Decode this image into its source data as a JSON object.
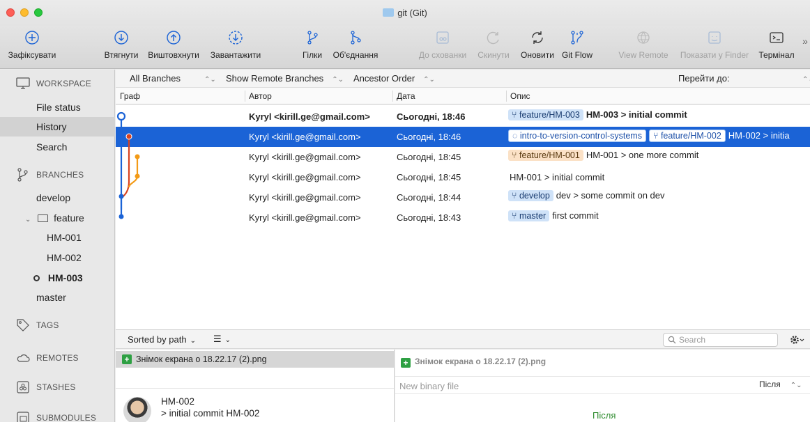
{
  "window": {
    "title": "git (Git)"
  },
  "toolbar": {
    "commit": "Зафіксувати",
    "pull": "Втягнути",
    "push": "Виштовхнути",
    "fetch": "Завантажити",
    "branch": "Гілки",
    "merge": "Об'єднання",
    "stash": "До схованки",
    "discard": "Скинути",
    "refresh": "Оновити",
    "gitflow": "Git Flow",
    "view_remote": "View Remote",
    "show_finder": "Показати у Finder",
    "terminal": "Термінал",
    "more": "»"
  },
  "sidebar": {
    "workspace": "WORKSPACE",
    "file_status": "File status",
    "history": "History",
    "search": "Search",
    "branches": "BRANCHES",
    "develop": "develop",
    "feature": "feature",
    "hm001": "HM-001",
    "hm002": "HM-002",
    "hm003": "HM-003",
    "master": "master",
    "tags": "TAGS",
    "remotes": "REMOTES",
    "stashes": "STASHES",
    "submodules": "SUBMODULES"
  },
  "filters": {
    "branches": "All Branches",
    "remote": "Show Remote Branches",
    "order": "Ancestor Order",
    "goto": "Перейти до:"
  },
  "columns": {
    "graph": "Граф",
    "author": "Автор",
    "date": "Дата",
    "description": "Опис"
  },
  "commits": [
    {
      "author": "Kyryl <kirill.ge@gmail.com>",
      "date": "Сьогодні, 18:46",
      "tags": [
        {
          "label": "feature/HM-003",
          "style": "blue",
          "kind": "branch"
        }
      ],
      "message": "HM-003 > initial commit"
    },
    {
      "author": "Kyryl <kirill.ge@gmail.com>",
      "date": "Сьогодні, 18:46",
      "tags": [
        {
          "label": "intro-to-version-control-systems",
          "style": "white",
          "kind": "tag"
        },
        {
          "label": "feature/HM-002",
          "style": "white",
          "kind": "branch"
        }
      ],
      "message": "HM-002 > initia"
    },
    {
      "author": "Kyryl <kirill.ge@gmail.com>",
      "date": "Сьогодні, 18:45",
      "tags": [
        {
          "label": "feature/HM-001",
          "style": "orange",
          "kind": "branch"
        }
      ],
      "message": "HM-001 > one more commit"
    },
    {
      "author": "Kyryl <kirill.ge@gmail.com>",
      "date": "Сьогодні, 18:45",
      "tags": [],
      "message": "HM-001 > initial commit"
    },
    {
      "author": "Kyryl <kirill.ge@gmail.com>",
      "date": "Сьогодні, 18:44",
      "tags": [
        {
          "label": "develop",
          "style": "blue",
          "kind": "branch"
        }
      ],
      "message": "dev > some commit on dev"
    },
    {
      "author": "Kyryl <kirill.ge@gmail.com>",
      "date": "Сьогодні, 18:43",
      "tags": [
        {
          "label": "master",
          "style": "blue",
          "kind": "branch"
        }
      ],
      "message": "first commit"
    }
  ],
  "bottom": {
    "sort": "Sorted by path",
    "search_placeholder": "Search",
    "file_name": "Знімок екрана  о 18.22.17 (2).png",
    "commit_branch": "HM-002",
    "commit_message": "> initial commit HM-002",
    "diff_file": "Знімок екрана  о 18.22.17 (2).png",
    "new_binary": "New binary file",
    "after_select": "Після",
    "after_label": "Після"
  },
  "colors": {
    "selection": "#1b63d6",
    "graph_blue": "#1b63d6",
    "graph_red": "#d9431f",
    "graph_orange": "#f39a16"
  }
}
